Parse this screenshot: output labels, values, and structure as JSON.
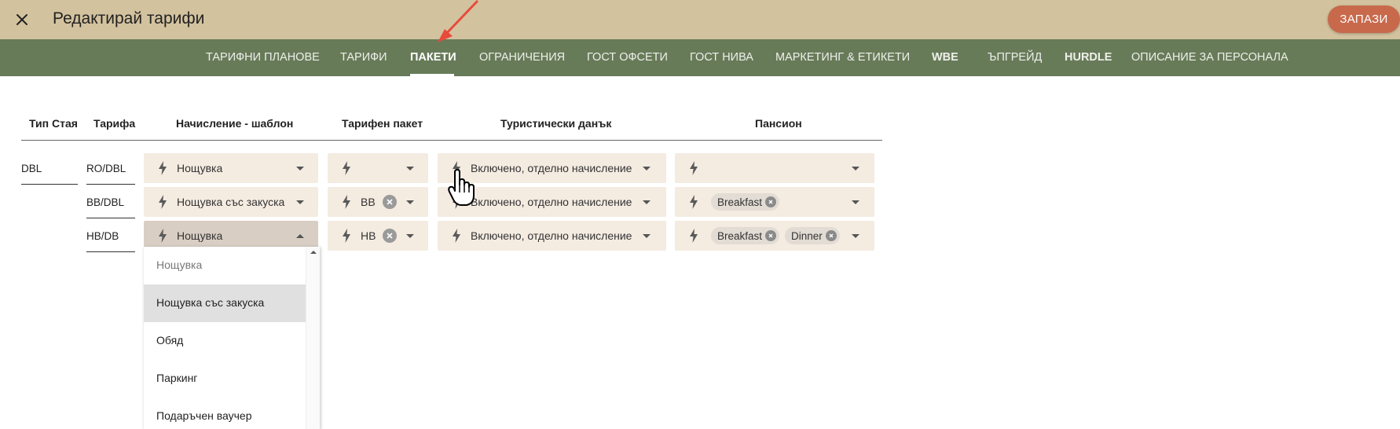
{
  "header": {
    "title": "Редактирай тарифи",
    "save_label": "ЗАПАЗИ"
  },
  "tabs": [
    {
      "label": "ТАРИФНИ ПЛАНОВЕ"
    },
    {
      "label": "ТАРИФИ"
    },
    {
      "label": "ПАКЕТИ",
      "active": true
    },
    {
      "label": "ОГРАНИЧЕНИЯ"
    },
    {
      "label": "ГОСТ ОФСЕТИ"
    },
    {
      "label": "ГОСТ НИВА"
    },
    {
      "label": "МАРКЕТИНГ & ЕТИКЕТИ"
    },
    {
      "label": "WBE"
    },
    {
      "label": "ЪПГРЕЙД"
    },
    {
      "label": "HURDLE"
    },
    {
      "label": "ОПИСАНИЕ ЗА ПЕРСОНАЛА"
    }
  ],
  "table": {
    "headers": {
      "room_type": "Тип Стая",
      "tariff": "Тарифа",
      "charge_template": "Начисление - шаблон",
      "tariff_package": "Тарифен пакет",
      "tourist_tax": "Туристически данък",
      "board": "Пансион"
    },
    "room_type": "DBL",
    "rows": [
      {
        "tariff": "RO/DBL",
        "charge_template": "Нощувка",
        "tariff_package": "",
        "tourist_tax": "Включено, отделно начисление",
        "board": []
      },
      {
        "tariff": "BB/DBL",
        "charge_template": "Нощувка със закуска",
        "tariff_package": "BB",
        "tourist_tax": "Включено, отделно начисление",
        "board": [
          "Breakfast"
        ]
      },
      {
        "tariff": "HB/DB",
        "charge_template": "Нощувка",
        "tariff_package": "HB",
        "tourist_tax": "Включено, отделно начисление",
        "board": [
          "Breakfast",
          "Dinner"
        ]
      }
    ]
  },
  "dropdown": {
    "options": [
      "Нощувка",
      "Нощувка със закуска",
      "Обяд",
      "Паркинг",
      "Подаръчен ваучер"
    ],
    "highlighted": "Нощувка със закуска"
  },
  "colors": {
    "topbar": "#d3c29e",
    "navbar": "#687b59",
    "save_button": "#c8694c",
    "select_bg": "#f4ebe1",
    "annotation_arrow": "#e84a3c"
  },
  "icons": [
    "close-icon",
    "bolt-icon",
    "clear-icon",
    "chevron-down-icon",
    "chevron-up-icon",
    "hand-cursor-icon",
    "arrow-annotation"
  ]
}
